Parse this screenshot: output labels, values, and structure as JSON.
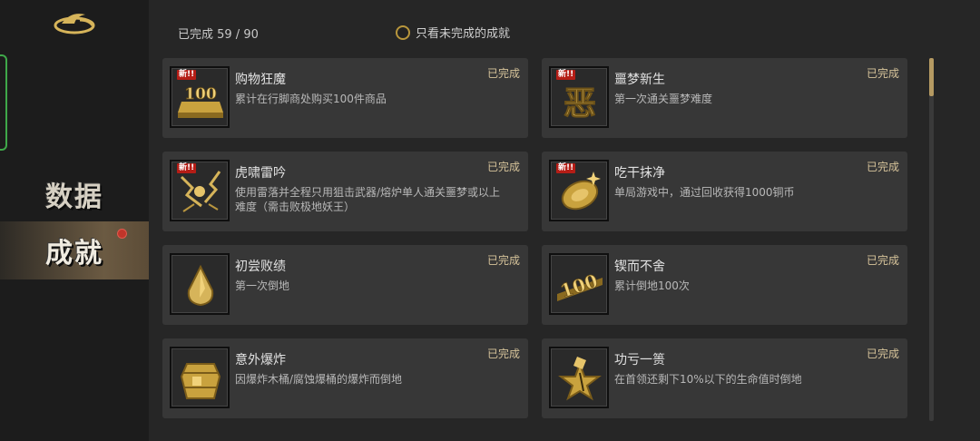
{
  "sidebar": {
    "items": [
      {
        "label": "数据"
      },
      {
        "label": "成就"
      }
    ]
  },
  "header": {
    "counter": "已完成 59 / 90",
    "filter_label": "只看未完成的成就"
  },
  "new_badge": "新!!",
  "achievements": [
    {
      "title": "购物狂魔",
      "desc": "累计在行脚商处购买100件商品",
      "status": "已完成",
      "icon": "gold-bar-100-icon",
      "is_new": true,
      "icon_text": "100"
    },
    {
      "title": "噩梦新生",
      "desc": "第一次通关噩梦难度",
      "status": "已完成",
      "icon": "nightmare-glyph-icon",
      "is_new": true,
      "icon_text": "恶"
    },
    {
      "title": "虎啸雷吟",
      "desc": "使用雷落并全程只用狙击武器/熔炉单人通关噩梦或以上难度（需击败极地妖王）",
      "status": "已完成",
      "icon": "lightning-burst-icon",
      "is_new": true
    },
    {
      "title": "吃干抹净",
      "desc": "单局游戏中，通过回收获得1000铜币",
      "status": "已完成",
      "icon": "gold-coin-icon",
      "is_new": true
    },
    {
      "title": "初尝败绩",
      "desc": "第一次倒地",
      "status": "已完成",
      "icon": "gold-drop-icon",
      "is_new": false
    },
    {
      "title": "锲而不舍",
      "desc": "累计倒地100次",
      "status": "已完成",
      "icon": "gold-100-plate-icon",
      "is_new": false,
      "icon_text": "100"
    },
    {
      "title": "意外爆炸",
      "desc": "因爆炸木桶/腐蚀爆桶的爆炸而倒地",
      "status": "已完成",
      "icon": "gold-barrel-icon",
      "is_new": false
    },
    {
      "title": "功亏一篑",
      "desc": "在首领还剩下10%以下的生命值时倒地",
      "status": "已完成",
      "icon": "broken-star-icon",
      "is_new": false
    }
  ],
  "colors": {
    "accent_gold": "#d6b45a",
    "new_badge_red": "#b51d16",
    "active_tab": "#6b5a42",
    "green_edge": "#3fa84a"
  }
}
